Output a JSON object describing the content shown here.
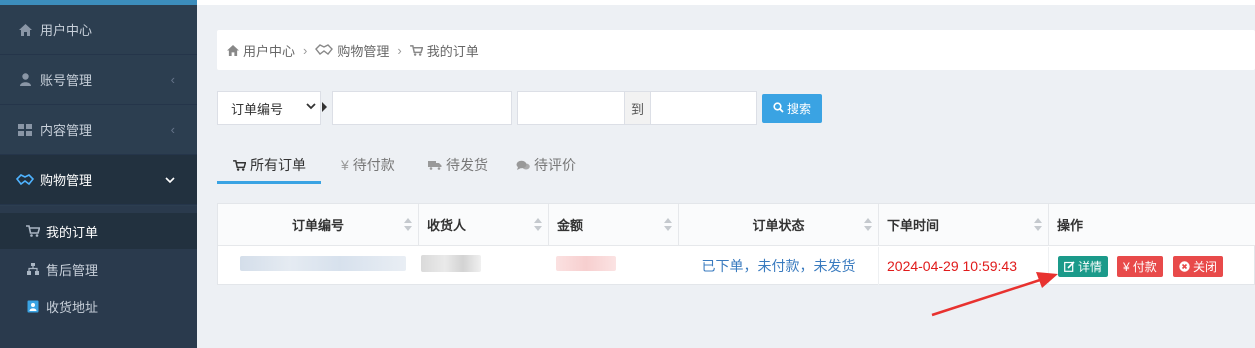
{
  "sidebar": {
    "items": [
      {
        "label": "用户中心",
        "icon": "home-icon"
      },
      {
        "label": "账号管理",
        "icon": "user-icon"
      },
      {
        "label": "内容管理",
        "icon": "grid-icon"
      },
      {
        "label": "购物管理",
        "icon": "handshake-icon"
      }
    ],
    "sub_items": [
      {
        "label": "我的订单",
        "icon": "cart-icon"
      },
      {
        "label": "售后管理",
        "icon": "sitemap-icon"
      },
      {
        "label": "收货地址",
        "icon": "address-book-icon"
      }
    ]
  },
  "breadcrumb": {
    "items": [
      "用户中心",
      "购物管理",
      "我的订单"
    ]
  },
  "search": {
    "field_select": "订单编号",
    "keyword_value": "",
    "date_from": "",
    "date_separator": "到",
    "date_to": "",
    "button_label": "搜索"
  },
  "tabs": [
    {
      "label": "所有订单",
      "icon": "cart-icon"
    },
    {
      "label": "待付款",
      "icon": "yen-icon"
    },
    {
      "label": "待发货",
      "icon": "truck-icon"
    },
    {
      "label": "待评价",
      "icon": "comments-icon"
    }
  ],
  "table": {
    "columns": [
      "订单编号",
      "收货人",
      "金额",
      "订单状态",
      "下单时间",
      "操作"
    ],
    "rows": [
      {
        "status": "已下单，未付款，未发货",
        "time": "2024-04-29 10:59:43",
        "actions": [
          {
            "label": "详情",
            "icon": "edit-icon"
          },
          {
            "label": "付款",
            "icon": "yen-icon"
          },
          {
            "label": "关闭",
            "icon": "close-circle-icon"
          }
        ]
      }
    ]
  },
  "colors": {
    "sidebar_bg": "#2c3e50",
    "accent": "#3aa3e3",
    "detail_button": "#1b9a8a",
    "danger_button": "#e84a4a",
    "time_text": "#e01b1b",
    "status_text": "#3a7bbf",
    "annotation_arrow": "#e8322f"
  }
}
